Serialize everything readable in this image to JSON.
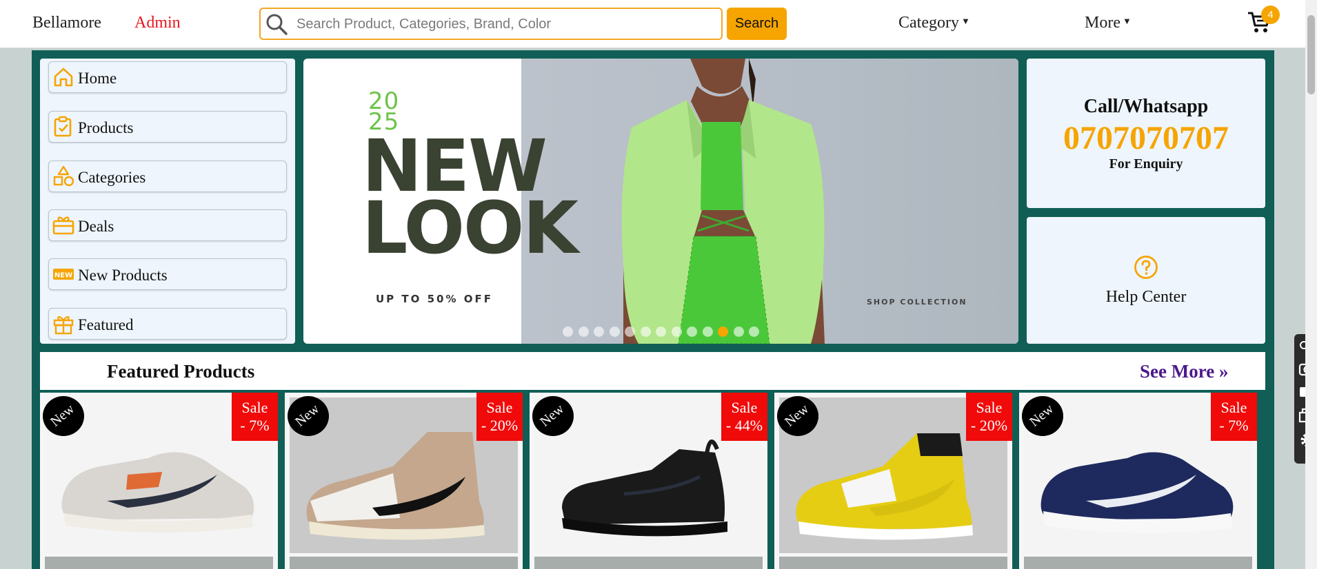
{
  "header": {
    "brand": "Bellamore",
    "admin_link": "Admin",
    "search_placeholder": "Search Product, Categories, Brand, Color",
    "search_button": "Search",
    "category_menu": "Category",
    "more_menu": "More",
    "cart_count": "4",
    "accent_color": "#f6a400"
  },
  "sidebar": {
    "items": [
      {
        "label": "Home",
        "icon": "home-icon"
      },
      {
        "label": "Products",
        "icon": "clipboard-check-icon"
      },
      {
        "label": "Categories",
        "icon": "shapes-icon"
      },
      {
        "label": "Deals",
        "icon": "gift-box-icon"
      },
      {
        "label": "New Products",
        "icon": "new-badge-icon"
      },
      {
        "label": "Featured",
        "icon": "gift-icon"
      }
    ]
  },
  "banner": {
    "year_top": "20",
    "year_bottom": "25",
    "headline_line1": "NEW",
    "headline_line2": "LOOK",
    "offer": "UP TO 50% OFF",
    "cta": "SHOP COLLECTION",
    "slide_count": 13,
    "active_slide": 10
  },
  "contact": {
    "title": "Call/Whatsapp",
    "phone": "0707070707",
    "subtitle": "For Enquiry"
  },
  "help": {
    "label": "Help Center",
    "icon": "question-circle-icon"
  },
  "featured": {
    "title": "Featured Products",
    "see_more": "See More »",
    "products": [
      {
        "new_label": "New",
        "sale_label": "Sale",
        "discount": "- 7%",
        "shoe_color": "#d9d6d2",
        "swoosh_color": "#2a3140"
      },
      {
        "new_label": "New",
        "sale_label": "Sale",
        "discount": "- 20%",
        "shoe_color": "#c4a78d",
        "swoosh_color": "#111111"
      },
      {
        "new_label": "New",
        "sale_label": "Sale",
        "discount": "- 44%",
        "shoe_color": "#1a1a1a",
        "swoosh_color": "#2a2f3d"
      },
      {
        "new_label": "New",
        "sale_label": "Sale",
        "discount": "- 20%",
        "shoe_color": "#e5cd14",
        "swoosh_color": "#d8c010"
      },
      {
        "new_label": "New",
        "sale_label": "Sale",
        "discount": "- 7%",
        "shoe_color": "#1e2a5e",
        "swoosh_color": "#e9ecf2"
      }
    ]
  }
}
